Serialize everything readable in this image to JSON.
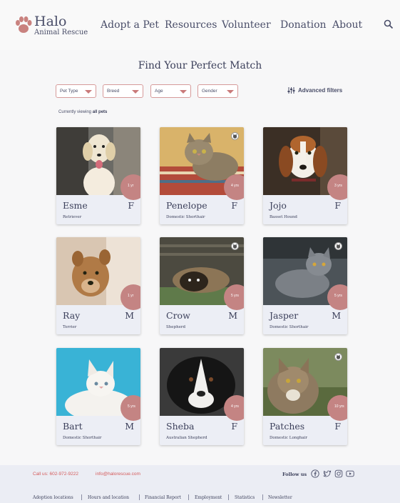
{
  "brand": {
    "name": "Halo",
    "subtitle": "Animal Rescue"
  },
  "nav": [
    "Adopt a Pet",
    "Resources",
    "Volunteer",
    "Donation",
    "About"
  ],
  "page_title": "Find Your Perfect Match",
  "filters": [
    "Pet Type",
    "Breed",
    "Age",
    "Gender"
  ],
  "advanced_filters": "Advanced filters",
  "viewing": {
    "prefix": "Currently viewing",
    "value": "all pets"
  },
  "pets": [
    {
      "name": "Esme",
      "sex": "F",
      "breed": "Retriever",
      "age": "1 yr",
      "kind": "dog"
    },
    {
      "name": "Penelope",
      "sex": "F",
      "breed": "Domestic Shorthair",
      "age": "4 yrs",
      "kind": "cat"
    },
    {
      "name": "Jojo",
      "sex": "F",
      "breed": "Basset Hound",
      "age": "3 yrs",
      "kind": "dog"
    },
    {
      "name": "Ray",
      "sex": "M",
      "breed": "Terrier",
      "age": "1 yr",
      "kind": "dog"
    },
    {
      "name": "Crow",
      "sex": "M",
      "breed": "Shepherd",
      "age": "5 yrs",
      "kind": "cat"
    },
    {
      "name": "Jasper",
      "sex": "M",
      "breed": "Domestic Shorthair",
      "age": "5 yrs",
      "kind": "cat"
    },
    {
      "name": "Bart",
      "sex": "M",
      "breed": "Domestic Shorthair",
      "age": "5 yrs",
      "kind": "cat"
    },
    {
      "name": "Sheba",
      "sex": "F",
      "breed": "Australian Shepherd",
      "age": "4 yrs",
      "kind": "dog"
    },
    {
      "name": "Patches",
      "sex": "F",
      "breed": "Domestic Longhair",
      "age": "10 yrs",
      "kind": "cat"
    }
  ],
  "footer": {
    "phone": "Call us: 602-972-9222",
    "email": "info@halorescue.com",
    "follow": "Follow us",
    "social_icons": [
      "facebook-icon",
      "twitter-icon",
      "instagram-icon",
      "youtube-icon"
    ],
    "links": [
      "Adoption locations",
      "Hours and location",
      "Financial Report",
      "Employment",
      "Statistics",
      "Newsletter"
    ]
  },
  "colors": {
    "accent": "#c48483",
    "text": "#3b3f5a",
    "card": "#eceef5",
    "footer": "#ebedf4"
  }
}
